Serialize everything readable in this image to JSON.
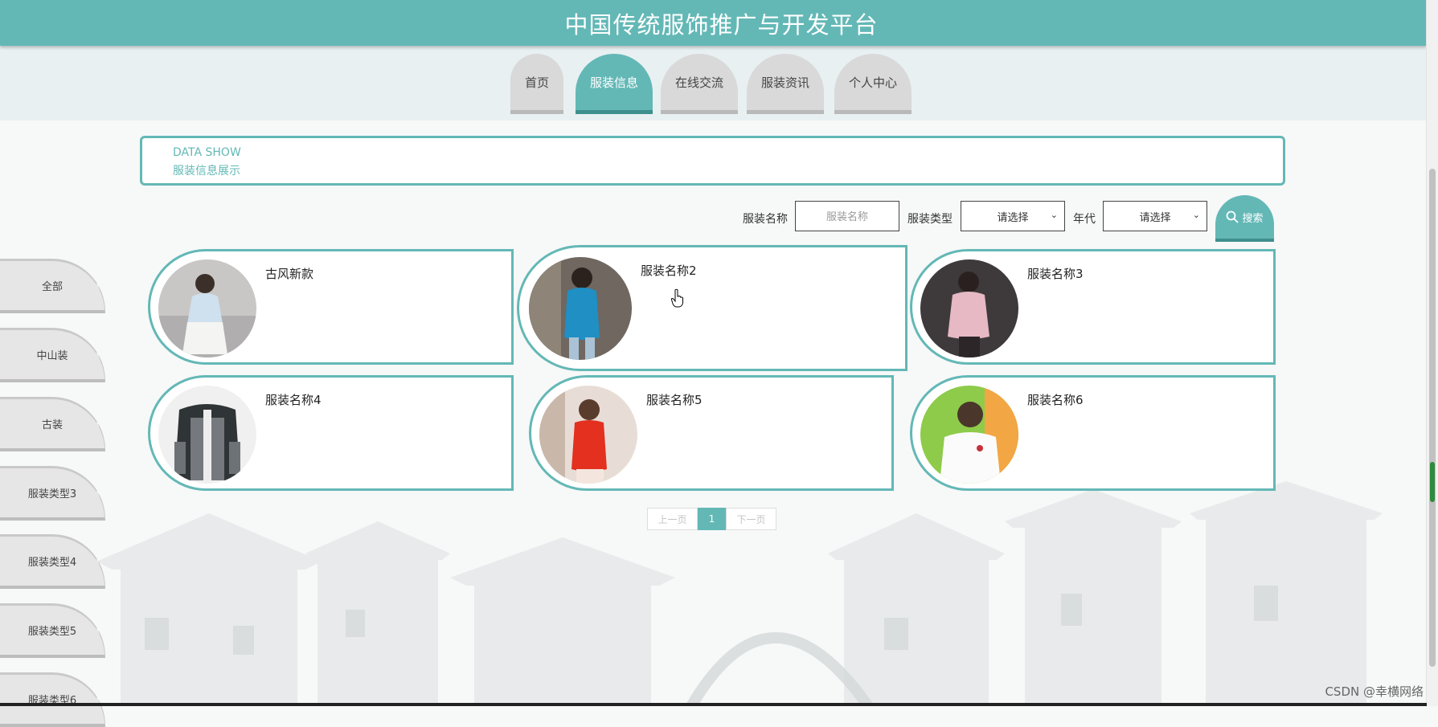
{
  "header": {
    "title": "中国传统服饰推广与开发平台"
  },
  "nav": {
    "tabs": [
      {
        "label": "首页"
      },
      {
        "label": "服装信息",
        "active": true
      },
      {
        "label": "在线交流"
      },
      {
        "label": "服装资讯"
      },
      {
        "label": "个人中心"
      }
    ]
  },
  "section": {
    "title_en": "DATA SHOW",
    "title_cn": "服装信息展示"
  },
  "search": {
    "name_label": "服装名称",
    "name_placeholder": "服装名称",
    "type_label": "服装类型",
    "type_value": "请选择",
    "era_label": "年代",
    "era_value": "请选择",
    "button_label": "搜索"
  },
  "categories": [
    {
      "label": "全部"
    },
    {
      "label": "中山装"
    },
    {
      "label": "古装"
    },
    {
      "label": "服装类型3"
    },
    {
      "label": "服装类型4"
    },
    {
      "label": "服装类型5"
    },
    {
      "label": "服装类型6"
    }
  ],
  "products": [
    {
      "name": "古风新款"
    },
    {
      "name": "服装名称2"
    },
    {
      "name": "服装名称3"
    },
    {
      "name": "服装名称4"
    },
    {
      "name": "服装名称5"
    },
    {
      "name": "服装名称6"
    }
  ],
  "pagination": {
    "prev_label": "上一页",
    "current_page": "1",
    "next_label": "下一页"
  },
  "watermark": "CSDN @幸横网络",
  "colors": {
    "accent": "#63b8b6",
    "accent_dark": "#3f8f8d",
    "tab_gray": "#d9d9d9"
  },
  "icons": {
    "search": "search-icon",
    "select_arrow": "chevron-down-icon"
  }
}
